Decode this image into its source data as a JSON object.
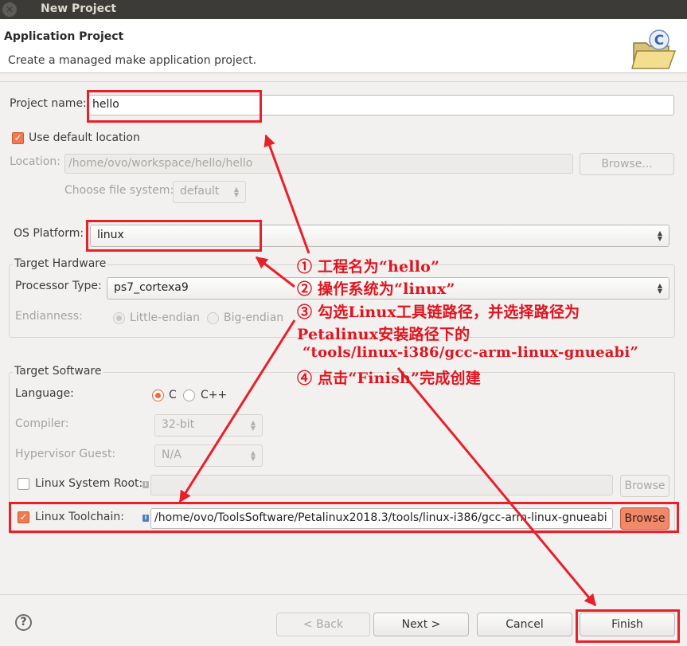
{
  "window": {
    "title": "New Project"
  },
  "header": {
    "title": "Application Project",
    "description": "Create a managed make application project."
  },
  "project": {
    "name_label": "Project name:",
    "name_value": "hello"
  },
  "location": {
    "use_default_label": "Use default location",
    "use_default_checked": true,
    "label": "Location:",
    "value": "/home/ovo/workspace/hello/hello",
    "browse_label": "Browse...",
    "fs_label": "Choose file system:",
    "fs_value": "default"
  },
  "os_platform": {
    "label": "OS Platform:",
    "value": "linux"
  },
  "target_hardware": {
    "group_title": "Target Hardware",
    "processor_label": "Processor Type:",
    "processor_value": "ps7_cortexa9",
    "endianness_label": "Endianness:",
    "little_endian": "Little-endian",
    "big_endian": "Big-endian"
  },
  "target_software": {
    "group_title": "Target Software",
    "language_label": "Language:",
    "lang_c": "C",
    "lang_cpp": "C++",
    "compiler_label": "Compiler:",
    "compiler_value": "32-bit",
    "hypervisor_label": "Hypervisor Guest:",
    "hypervisor_value": "N/A",
    "sysroot_label": "Linux System Root:",
    "sysroot_browse": "Browse",
    "toolchain_label": "Linux Toolchain:",
    "toolchain_value": "/home/ovo/ToolsSoftware/Petalinux2018.3/tools/linux-i386/gcc-arm-linux-gnueabi",
    "toolchain_browse": "Browse"
  },
  "annotations": {
    "line1": "① 工程名为“hello”",
    "line2": "② 操作系统为“linux”",
    "line3": "③ 勾选Linux工具链路径，并选择路径为",
    "line4": "Petalinux安装路径下的",
    "line5": "“tools/linux-i386/gcc-arm-linux-gnueabi”",
    "line6": "④ 点击“Finish”完成创建"
  },
  "footer": {
    "help_icon": "?",
    "back_label": "< Back",
    "next_label": "Next >",
    "cancel_label": "Cancel",
    "finish_label": "Finish"
  },
  "colors": {
    "accent": "#ef7a52",
    "annotation_red": "#e8202a",
    "titlebar": "#3c3b37"
  }
}
